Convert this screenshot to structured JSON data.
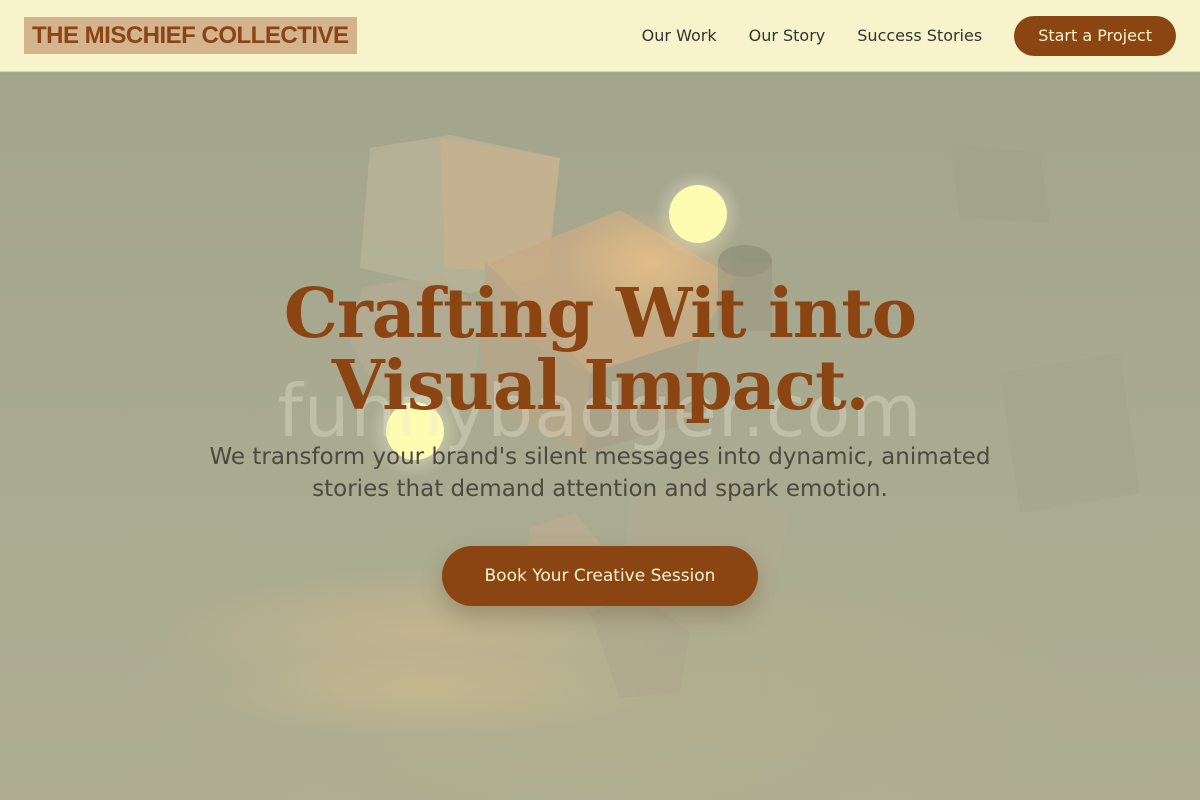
{
  "header": {
    "logo": "THE MISCHIEF COLLECTIVE",
    "nav": [
      "Our Work",
      "Our Story",
      "Success Stories"
    ],
    "cta": "Start a Project"
  },
  "hero": {
    "title_line1": "Crafting Wit into",
    "title_line2": "Visual Impact.",
    "subtitle": "We transform your brand's silent messages into dynamic, animated stories that demand attention and spark emotion.",
    "cta": "Book Your Creative Session",
    "watermark": "funnybadger.com"
  },
  "colors": {
    "accent": "#8b4513",
    "header_bg": "#f7f4cc",
    "logo_bg": "#d4b48e",
    "glow": "#fdfcb0"
  }
}
